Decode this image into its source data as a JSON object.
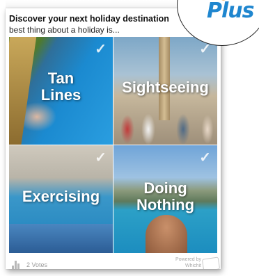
{
  "poll": {
    "title": "Discover your next holiday destination",
    "subtitle": "best thing about a holiday is...",
    "options": [
      {
        "label_line1": "Tan",
        "label_line2": "Lines"
      },
      {
        "label_line1": "Sightseeing",
        "label_line2": ""
      },
      {
        "label_line1": "Exercising",
        "label_line2": ""
      },
      {
        "label_line1": "Doing",
        "label_line2": "Nothing"
      }
    ],
    "check_glyph": "✓",
    "votes_text": "2 Votes",
    "powered_line1": "Powered by",
    "powered_line2": "Whichit"
  },
  "logo": {
    "text": "Plus"
  },
  "icons": {
    "check": "check-icon",
    "votes": "bar-chart-icon",
    "brand": "whichit-logo-icon"
  }
}
